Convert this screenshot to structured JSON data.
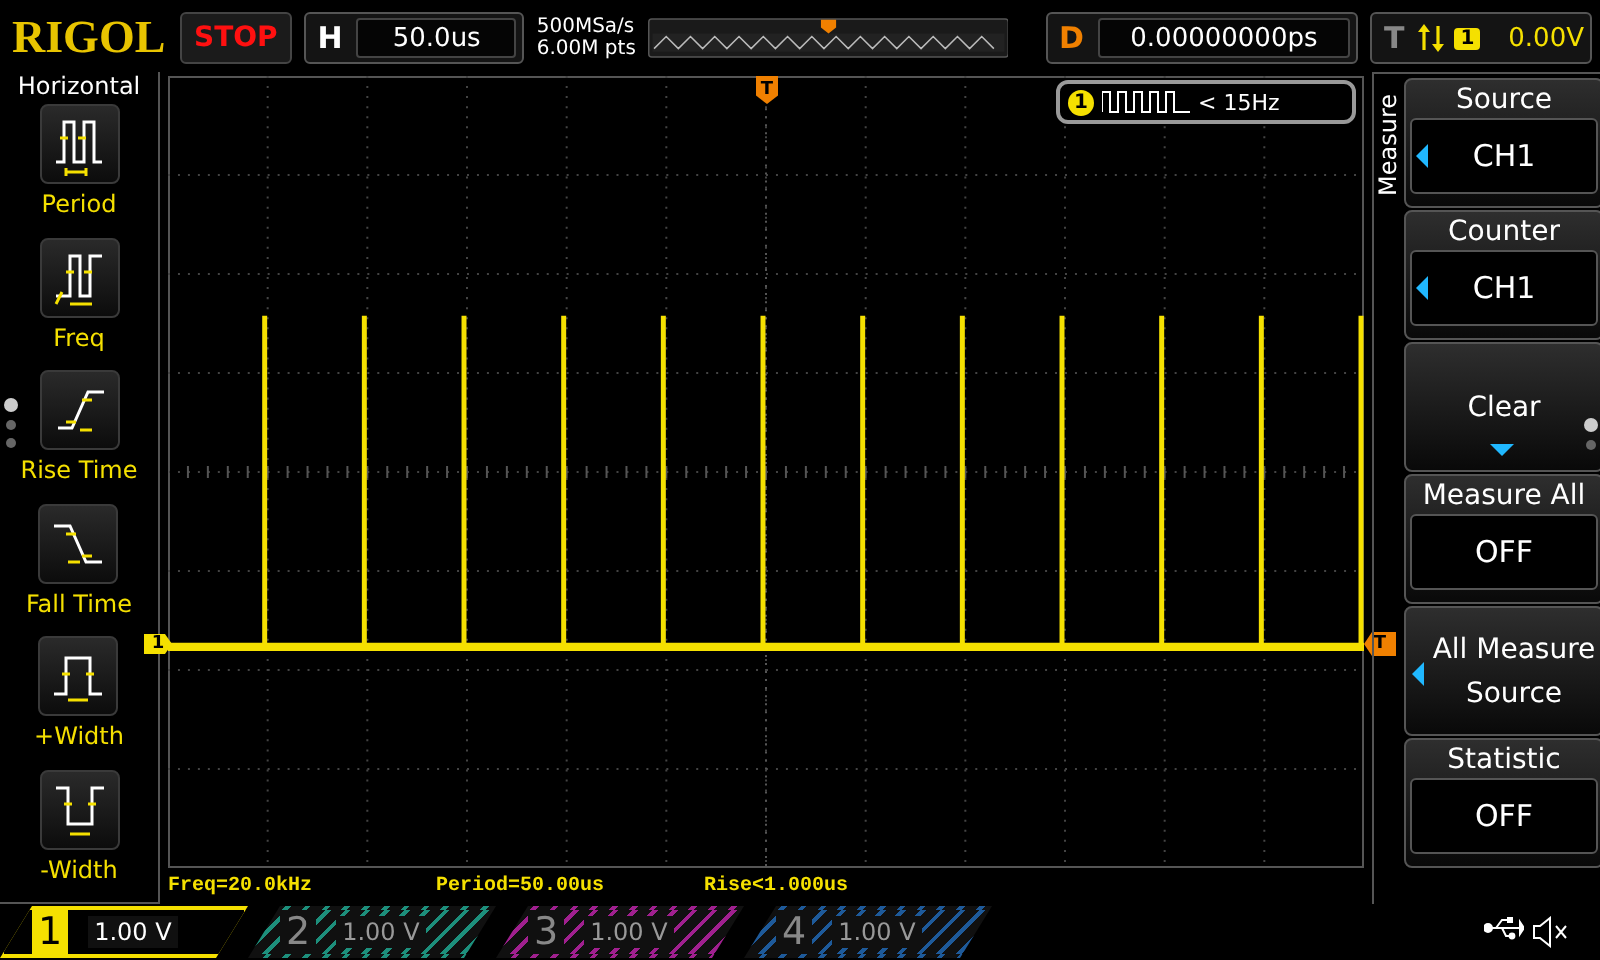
{
  "top_bar": {
    "logo": "RIGOL",
    "run_state": "STOP",
    "horizontal": {
      "label": "H",
      "value": "50.0us"
    },
    "sampling": {
      "rate": "500MSa/s",
      "depth": "6.00M pts"
    },
    "delay": {
      "label": "D",
      "value": "0.00000000ps"
    },
    "trigger": {
      "label": "T",
      "source": "1",
      "level": "0.00V"
    }
  },
  "left_menu": {
    "title": "Horizontal",
    "items": [
      {
        "kind": "period",
        "label": "Period"
      },
      {
        "kind": "freq",
        "label": "Freq"
      },
      {
        "kind": "rise",
        "label": "Rise Time"
      },
      {
        "kind": "fall",
        "label": "Fall Time"
      },
      {
        "kind": "pwidth",
        "label": "+Width"
      },
      {
        "kind": "nwidth",
        "label": "-Width"
      }
    ],
    "pages": [
      {
        "selected": true
      },
      {
        "selected": false
      },
      {
        "selected": false
      }
    ]
  },
  "display": {
    "trigger_position_marker": "T",
    "channel_marker": "1",
    "trigger_level_marker": "T",
    "counter": {
      "channel": "1",
      "reading": "< 15Hz"
    }
  },
  "measurements": [
    "Freq=20.0kHz",
    "Period=50.00us",
    "Rise<1.000us"
  ],
  "right_menu": {
    "title": "Measure",
    "items": [
      {
        "kind": "select",
        "label": "Source",
        "value": "CH1"
      },
      {
        "kind": "select",
        "label": "Counter",
        "value": "CH1"
      },
      {
        "kind": "expand",
        "label": "Clear"
      },
      {
        "kind": "toggle",
        "label": "Measure All",
        "value": "OFF"
      },
      {
        "kind": "cycle",
        "label": "All Measure Source"
      },
      {
        "kind": "toggle",
        "label": "Statistic",
        "value": "OFF"
      }
    ],
    "pages": [
      {
        "selected": true
      },
      {
        "selected": false
      }
    ]
  },
  "channels": [
    {
      "number": "1",
      "scale": "1.00 V",
      "active": true,
      "color": "#f5e000"
    },
    {
      "number": "2",
      "scale": "1.00 V",
      "active": false,
      "color": "#1d8f7c"
    },
    {
      "number": "3",
      "scale": "1.00 V",
      "active": false,
      "color": "#a0208f"
    },
    {
      "number": "4",
      "scale": "1.00 V",
      "active": false,
      "color": "#1e5a9a"
    }
  ]
}
